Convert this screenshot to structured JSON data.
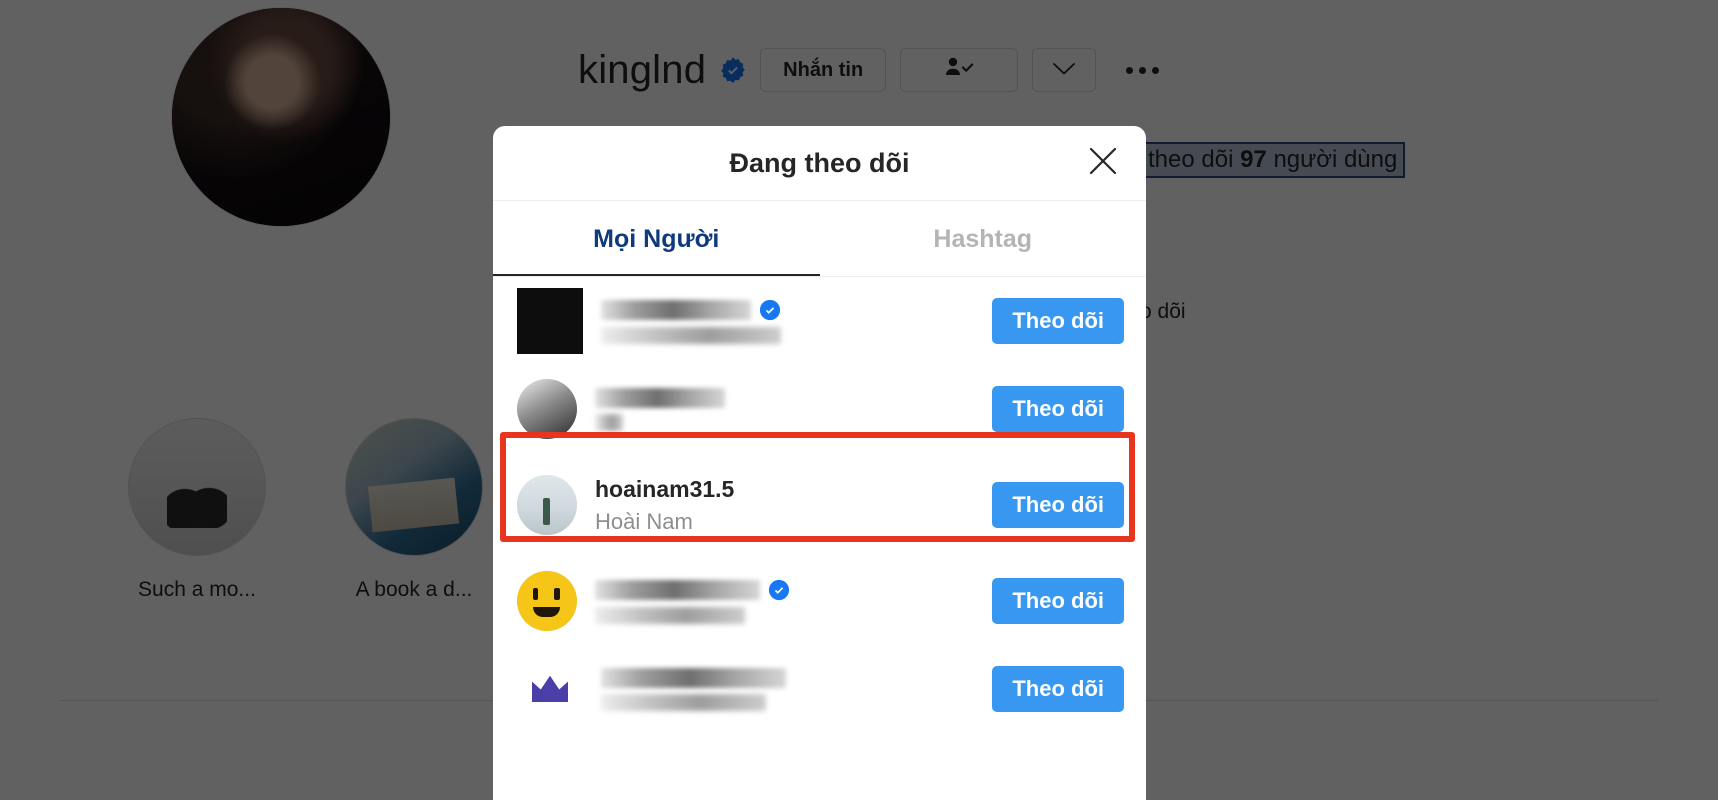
{
  "profile": {
    "username": "kinglnd",
    "verified": true,
    "verified_icon": "verified-badge-icon",
    "message_button": "Nhắn tin",
    "following_icon": "person-check-icon",
    "chevron_icon": "chevron-down-icon",
    "more_icon": "more-options-icon",
    "stats_prefix": "theo dõi ",
    "stats_count": "97",
    "stats_suffix": " người dùng",
    "side_follow_text": "o dõi",
    "highlights": [
      {
        "label": "Such a mo...",
        "thumb": "highlight-thumb-1"
      },
      {
        "label": "A book a d...",
        "thumb": "highlight-thumb-2"
      }
    ]
  },
  "modal": {
    "title": "Đang theo dõi",
    "close_icon": "close-icon",
    "tabs": [
      {
        "label": "Mọi Người",
        "active": true
      },
      {
        "label": "Hashtag",
        "active": false
      }
    ],
    "follow_button_label": "Theo dõi",
    "accent_color": "#3897f0",
    "rows": [
      {
        "username": "",
        "fullname": "",
        "censored": true,
        "verified": true,
        "has_story_ring": true,
        "avatar_kind": "dark-logo-avatar",
        "follow_label": "Theo dõi"
      },
      {
        "username": "",
        "fullname": "",
        "censored": true,
        "verified": false,
        "has_story_ring": false,
        "avatar_kind": "grayscale-photo-avatar",
        "follow_label": "Theo dõi"
      },
      {
        "username": "hoainam31.5",
        "fullname": "Hoài Nam",
        "censored": false,
        "verified": false,
        "has_story_ring": false,
        "avatar_kind": "person-photo-avatar",
        "follow_label": "Theo dõi",
        "highlighted": true
      },
      {
        "username": "",
        "fullname": "",
        "censored": true,
        "verified": true,
        "has_story_ring": false,
        "avatar_kind": "yellow-smiley-avatar",
        "follow_label": "Theo dõi"
      },
      {
        "username": "",
        "fullname": "",
        "censored": true,
        "verified": false,
        "has_story_ring": true,
        "avatar_kind": "crown-logo-avatar",
        "follow_label": "Theo dõi"
      }
    ]
  },
  "annotation": {
    "color": "#e8351d",
    "target": "hoainam31.5"
  }
}
